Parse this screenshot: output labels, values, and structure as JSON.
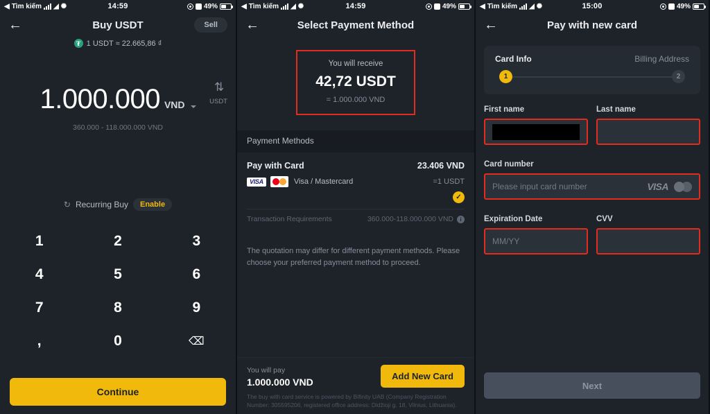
{
  "status_bar": {
    "carrier_label": "Tìm kiếm",
    "time_1": "14:59",
    "time_2": "14:59",
    "time_3": "15:00",
    "battery": "49%"
  },
  "panel1": {
    "title": "Buy USDT",
    "sell_label": "Sell",
    "rate": "1 USDT ≈ 22.665,86 ₫",
    "amount": "1.000.000",
    "currency": "VND",
    "range": "360.000 - 118.000.000 VND",
    "swap_target": "USDT",
    "recurring_label": "Recurring Buy",
    "enable_label": "Enable",
    "keypad": [
      "1",
      "2",
      "3",
      "4",
      "5",
      "6",
      "7",
      "8",
      "9",
      ",",
      "0",
      "⌫"
    ],
    "continue_label": "Continue"
  },
  "panel2": {
    "title": "Select Payment Method",
    "receive_label": "You will receive",
    "receive_value": "42,72 USDT",
    "receive_sub": "= 1.000.000 VND",
    "section_header": "Payment Methods",
    "method_name": "Pay with Card",
    "method_price": "23.406 VND",
    "method_brands": "Visa / Mastercard",
    "method_unit": "=1 USDT",
    "requirements_label": "Transaction Requirements",
    "requirements_value": "360.000-118.000.000 VND",
    "quote_note": "The quotation may differ for different payment methods. Please choose your preferred payment method to proceed.",
    "pay_label": "You will pay",
    "pay_value": "1.000.000 VND",
    "add_card_label": "Add New Card",
    "legal": "The buy with card service is powered by Bifinity UAB (Company Registration Number: 305595206, registered office address: Didžioji g. 18, Vilnius, Lithuania)."
  },
  "panel3": {
    "title": "Pay with new card",
    "step1_label": "Card Info",
    "step2_label": "Billing Address",
    "step1_num": "1",
    "step2_num": "2",
    "first_name_label": "First name",
    "last_name_label": "Last name",
    "card_number_label": "Card number",
    "card_number_placeholder": "Please input card number",
    "expiration_label": "Expiration Date",
    "expiration_placeholder": "MM/YY",
    "cvv_label": "CVV",
    "next_label": "Next"
  },
  "colors": {
    "accent": "#f0b90b",
    "annotation": "#e32b1e",
    "panel_bg": "#1e2329"
  }
}
